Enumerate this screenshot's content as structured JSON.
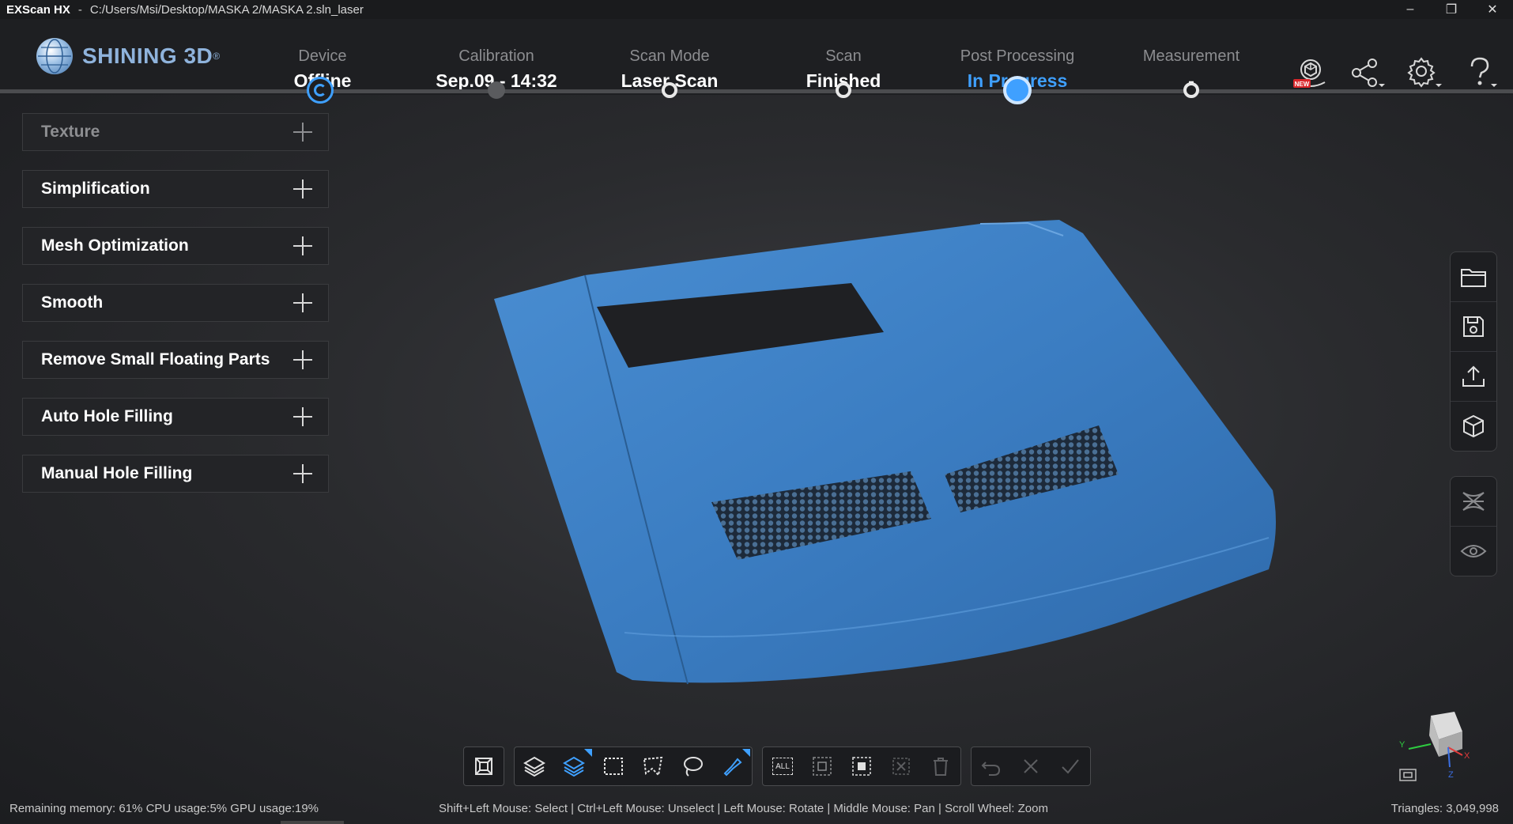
{
  "titlebar": {
    "app_name": "EXScan HX",
    "separator": "-",
    "path": "C:/Users/Msi/Desktop/MASKA 2/MASKA 2.sln_laser",
    "min": "–",
    "max": "❐",
    "close": "✕"
  },
  "logo": {
    "brand": "SHINING 3D",
    "reg": "®"
  },
  "steps": [
    {
      "label": "Device",
      "value": "Offline"
    },
    {
      "label": "Calibration",
      "value": "Sep.09 - 14:32"
    },
    {
      "label": "Scan Mode",
      "value": "Laser Scan"
    },
    {
      "label": "Scan",
      "value": "Finished"
    },
    {
      "label": "Post Processing",
      "value": "In Progress"
    },
    {
      "label": "Measurement",
      "value": "-"
    }
  ],
  "header_icons": [
    "3d-scan-new-icon",
    "share-icon",
    "settings-icon",
    "help-icon"
  ],
  "new_badge": "NEW",
  "panels": [
    {
      "label": "Texture",
      "enabled": false
    },
    {
      "label": "Simplification",
      "enabled": true
    },
    {
      "label": "Mesh Optimization",
      "enabled": true
    },
    {
      "label": "Smooth",
      "enabled": true
    },
    {
      "label": "Remove Small Floating Parts",
      "enabled": true
    },
    {
      "label": "Auto Hole Filling",
      "enabled": true
    },
    {
      "label": "Manual Hole Filling",
      "enabled": true
    }
  ],
  "right_toolbar": {
    "file": [
      "open-folder-icon",
      "save-icon",
      "export-icon",
      "3d-box-icon"
    ],
    "view": [
      "mesh-display-icon",
      "visibility-eye-icon"
    ]
  },
  "bottom_toolbar": {
    "all_label": "ALL"
  },
  "axes": {
    "x": "X",
    "y": "Y",
    "z": "Z"
  },
  "status": {
    "left": "Remaining memory: 61% CPU usage:5%  GPU usage:19%",
    "hint": "Shift+Left Mouse: Select | Ctrl+Left Mouse: Unselect | Left Mouse: Rotate | Middle Mouse: Pan | Scroll Wheel: Zoom",
    "triangles": "Triangles: 3,049,998"
  },
  "colors": {
    "accent": "#3fa0ff",
    "mesh": "#3d7fc4",
    "background": "#2a2b2e"
  }
}
